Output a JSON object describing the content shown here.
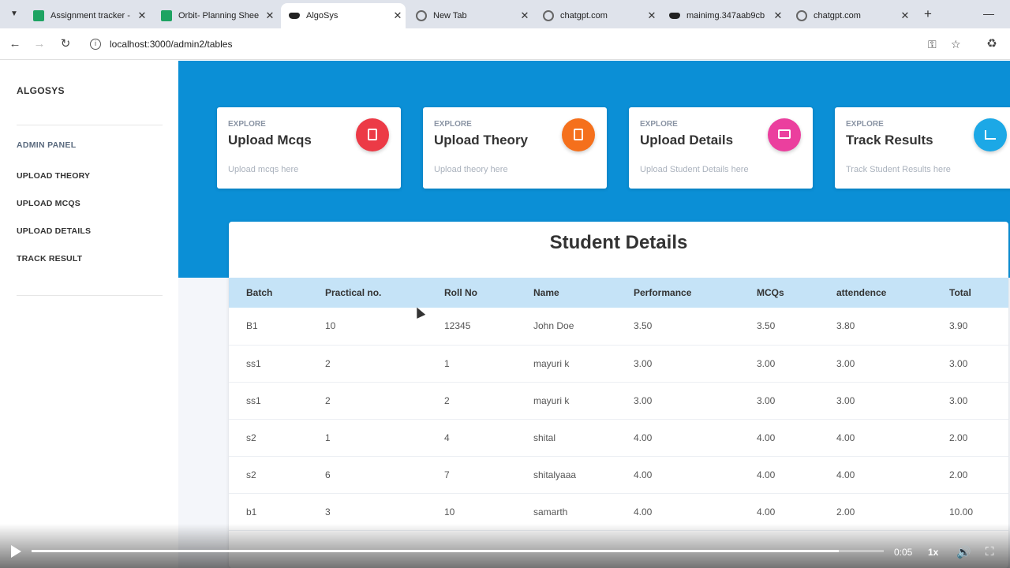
{
  "browser": {
    "tabs": [
      {
        "title": "Assignment tracker -",
        "favicon": "sheets-icon",
        "active": false
      },
      {
        "title": "Orbit- Planning Shee",
        "favicon": "sheets-icon",
        "active": false
      },
      {
        "title": "AlgoSys",
        "favicon": "mask-icon",
        "active": true
      },
      {
        "title": "New Tab",
        "favicon": "chrome-icon",
        "active": false
      },
      {
        "title": "chatgpt.com",
        "favicon": "globe-icon",
        "active": false
      },
      {
        "title": "mainimg.347aab9cb",
        "favicon": "mask-icon",
        "active": false
      },
      {
        "title": "chatgpt.com",
        "favicon": "globe-icon",
        "active": false
      }
    ],
    "url": "localhost:3000/admin2/tables"
  },
  "sidebar": {
    "brand": "ALGOSYS",
    "heading": "ADMIN PANEL",
    "items": [
      {
        "label": "UPLOAD THEORY"
      },
      {
        "label": "UPLOAD MCQS"
      },
      {
        "label": "UPLOAD DETAILS"
      },
      {
        "label": "TRACK RESULT"
      }
    ]
  },
  "cards": [
    {
      "eyebrow": "EXPLORE",
      "title": "Upload Mcqs",
      "desc": "Upload mcqs here",
      "color": "#ec3a46",
      "icon": "document-icon"
    },
    {
      "eyebrow": "EXPLORE",
      "title": "Upload Theory",
      "desc": "Upload theory here",
      "color": "#f5701c",
      "icon": "document-icon"
    },
    {
      "eyebrow": "EXPLORE",
      "title": "Upload Details",
      "desc": "Upload Student Details here",
      "color": "#eb3f9e",
      "icon": "monitor-icon"
    },
    {
      "eyebrow": "EXPLORE",
      "title": "Track Results",
      "desc": "Track Student Results here",
      "color": "#1ca8e6",
      "icon": "bar-chart-icon"
    }
  ],
  "table": {
    "title": "Student Details",
    "columns": [
      "Batch",
      "Practical no.",
      "Roll No",
      "Name",
      "Performance",
      "MCQs",
      "attendence",
      "Total"
    ],
    "rows": [
      [
        "B1",
        "10",
        "12345",
        "John Doe",
        "3.50",
        "3.50",
        "3.80",
        "3.90"
      ],
      [
        "ss1",
        "2",
        "1",
        "mayuri k",
        "3.00",
        "3.00",
        "3.00",
        "3.00"
      ],
      [
        "ss1",
        "2",
        "2",
        "mayuri k",
        "3.00",
        "3.00",
        "3.00",
        "3.00"
      ],
      [
        "s2",
        "1",
        "4",
        "shital",
        "4.00",
        "4.00",
        "4.00",
        "2.00"
      ],
      [
        "s2",
        "6",
        "7",
        "shitalyaaa",
        "4.00",
        "4.00",
        "4.00",
        "2.00"
      ],
      [
        "b1",
        "3",
        "10",
        "samarth",
        "4.00",
        "4.00",
        "2.00",
        "10.00"
      ]
    ]
  },
  "player": {
    "time": "0:05",
    "speed": "1x",
    "progress": 0.947
  },
  "colors": {
    "hero": "#0b8fd6",
    "table_header": "#c5e3f7"
  }
}
